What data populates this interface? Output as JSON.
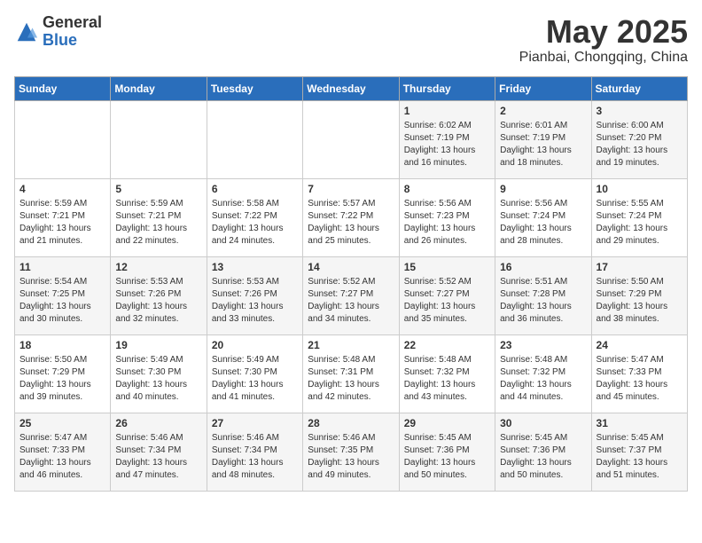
{
  "logo": {
    "general": "General",
    "blue": "Blue"
  },
  "header": {
    "month": "May 2025",
    "location": "Pianbai, Chongqing, China"
  },
  "weekdays": [
    "Sunday",
    "Monday",
    "Tuesday",
    "Wednesday",
    "Thursday",
    "Friday",
    "Saturday"
  ],
  "weeks": [
    [
      {
        "day": "",
        "detail": ""
      },
      {
        "day": "",
        "detail": ""
      },
      {
        "day": "",
        "detail": ""
      },
      {
        "day": "",
        "detail": ""
      },
      {
        "day": "1",
        "detail": "Sunrise: 6:02 AM\nSunset: 7:19 PM\nDaylight: 13 hours\nand 16 minutes."
      },
      {
        "day": "2",
        "detail": "Sunrise: 6:01 AM\nSunset: 7:19 PM\nDaylight: 13 hours\nand 18 minutes."
      },
      {
        "day": "3",
        "detail": "Sunrise: 6:00 AM\nSunset: 7:20 PM\nDaylight: 13 hours\nand 19 minutes."
      }
    ],
    [
      {
        "day": "4",
        "detail": "Sunrise: 5:59 AM\nSunset: 7:21 PM\nDaylight: 13 hours\nand 21 minutes."
      },
      {
        "day": "5",
        "detail": "Sunrise: 5:59 AM\nSunset: 7:21 PM\nDaylight: 13 hours\nand 22 minutes."
      },
      {
        "day": "6",
        "detail": "Sunrise: 5:58 AM\nSunset: 7:22 PM\nDaylight: 13 hours\nand 24 minutes."
      },
      {
        "day": "7",
        "detail": "Sunrise: 5:57 AM\nSunset: 7:22 PM\nDaylight: 13 hours\nand 25 minutes."
      },
      {
        "day": "8",
        "detail": "Sunrise: 5:56 AM\nSunset: 7:23 PM\nDaylight: 13 hours\nand 26 minutes."
      },
      {
        "day": "9",
        "detail": "Sunrise: 5:56 AM\nSunset: 7:24 PM\nDaylight: 13 hours\nand 28 minutes."
      },
      {
        "day": "10",
        "detail": "Sunrise: 5:55 AM\nSunset: 7:24 PM\nDaylight: 13 hours\nand 29 minutes."
      }
    ],
    [
      {
        "day": "11",
        "detail": "Sunrise: 5:54 AM\nSunset: 7:25 PM\nDaylight: 13 hours\nand 30 minutes."
      },
      {
        "day": "12",
        "detail": "Sunrise: 5:53 AM\nSunset: 7:26 PM\nDaylight: 13 hours\nand 32 minutes."
      },
      {
        "day": "13",
        "detail": "Sunrise: 5:53 AM\nSunset: 7:26 PM\nDaylight: 13 hours\nand 33 minutes."
      },
      {
        "day": "14",
        "detail": "Sunrise: 5:52 AM\nSunset: 7:27 PM\nDaylight: 13 hours\nand 34 minutes."
      },
      {
        "day": "15",
        "detail": "Sunrise: 5:52 AM\nSunset: 7:27 PM\nDaylight: 13 hours\nand 35 minutes."
      },
      {
        "day": "16",
        "detail": "Sunrise: 5:51 AM\nSunset: 7:28 PM\nDaylight: 13 hours\nand 36 minutes."
      },
      {
        "day": "17",
        "detail": "Sunrise: 5:50 AM\nSunset: 7:29 PM\nDaylight: 13 hours\nand 38 minutes."
      }
    ],
    [
      {
        "day": "18",
        "detail": "Sunrise: 5:50 AM\nSunset: 7:29 PM\nDaylight: 13 hours\nand 39 minutes."
      },
      {
        "day": "19",
        "detail": "Sunrise: 5:49 AM\nSunset: 7:30 PM\nDaylight: 13 hours\nand 40 minutes."
      },
      {
        "day": "20",
        "detail": "Sunrise: 5:49 AM\nSunset: 7:30 PM\nDaylight: 13 hours\nand 41 minutes."
      },
      {
        "day": "21",
        "detail": "Sunrise: 5:48 AM\nSunset: 7:31 PM\nDaylight: 13 hours\nand 42 minutes."
      },
      {
        "day": "22",
        "detail": "Sunrise: 5:48 AM\nSunset: 7:32 PM\nDaylight: 13 hours\nand 43 minutes."
      },
      {
        "day": "23",
        "detail": "Sunrise: 5:48 AM\nSunset: 7:32 PM\nDaylight: 13 hours\nand 44 minutes."
      },
      {
        "day": "24",
        "detail": "Sunrise: 5:47 AM\nSunset: 7:33 PM\nDaylight: 13 hours\nand 45 minutes."
      }
    ],
    [
      {
        "day": "25",
        "detail": "Sunrise: 5:47 AM\nSunset: 7:33 PM\nDaylight: 13 hours\nand 46 minutes."
      },
      {
        "day": "26",
        "detail": "Sunrise: 5:46 AM\nSunset: 7:34 PM\nDaylight: 13 hours\nand 47 minutes."
      },
      {
        "day": "27",
        "detail": "Sunrise: 5:46 AM\nSunset: 7:34 PM\nDaylight: 13 hours\nand 48 minutes."
      },
      {
        "day": "28",
        "detail": "Sunrise: 5:46 AM\nSunset: 7:35 PM\nDaylight: 13 hours\nand 49 minutes."
      },
      {
        "day": "29",
        "detail": "Sunrise: 5:45 AM\nSunset: 7:36 PM\nDaylight: 13 hours\nand 50 minutes."
      },
      {
        "day": "30",
        "detail": "Sunrise: 5:45 AM\nSunset: 7:36 PM\nDaylight: 13 hours\nand 50 minutes."
      },
      {
        "day": "31",
        "detail": "Sunrise: 5:45 AM\nSunset: 7:37 PM\nDaylight: 13 hours\nand 51 minutes."
      }
    ]
  ]
}
